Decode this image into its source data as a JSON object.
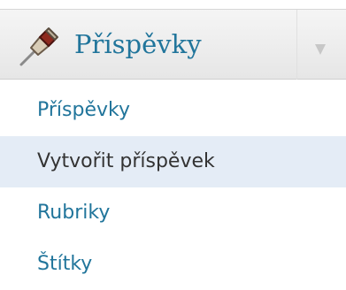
{
  "menu": {
    "title": "Příspěvky",
    "icon": "pushpin-icon",
    "toggle_icon": "chevron-down-icon",
    "colors": {
      "link": "#21759b",
      "current_text": "#333333",
      "current_background": "#e4ecf6",
      "header_background": "#eeeeee"
    },
    "items": [
      {
        "label": "Příspěvky",
        "current": false
      },
      {
        "label": "Vytvořit příspěvek",
        "current": true
      },
      {
        "label": "Rubriky",
        "current": false
      },
      {
        "label": "Štítky",
        "current": false
      }
    ]
  }
}
